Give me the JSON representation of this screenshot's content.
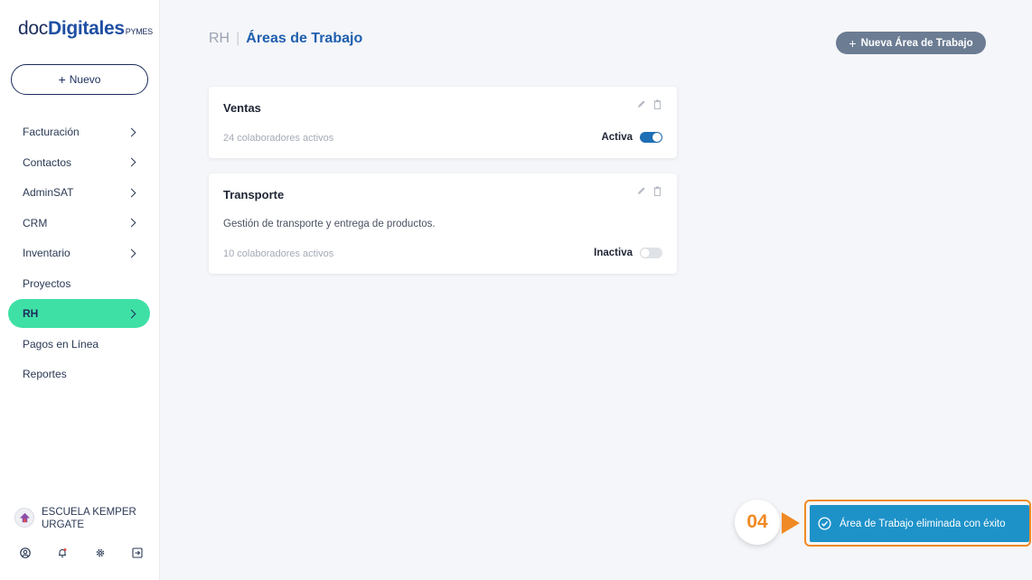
{
  "brand": {
    "part1": "doc",
    "part2": "Digitales",
    "suffix": "PYMES"
  },
  "sidebar": {
    "new_button": "Nuevo",
    "items": [
      {
        "label": "Facturación",
        "has_chevron": true
      },
      {
        "label": "Contactos",
        "has_chevron": true
      },
      {
        "label": "AdminSAT",
        "has_chevron": true
      },
      {
        "label": "CRM",
        "has_chevron": true
      },
      {
        "label": "Inventario",
        "has_chevron": true
      },
      {
        "label": "Proyectos",
        "has_chevron": false
      },
      {
        "label": "RH",
        "has_chevron": true,
        "active": true
      },
      {
        "label": "Pagos en Línea",
        "has_chevron": false
      },
      {
        "label": "Reportes",
        "has_chevron": false
      }
    ],
    "org_name_line1": "ESCUELA KEMPER",
    "org_name_line2": "URGATE",
    "bottom_icons": [
      "user-icon",
      "bell-icon",
      "gear-icon",
      "logout-icon"
    ]
  },
  "header": {
    "breadcrumb_root": "RH",
    "breadcrumb_sep": "|",
    "breadcrumb_current": "Áreas de Trabajo",
    "add_button": "Nueva Área de Trabajo"
  },
  "cards": [
    {
      "title": "Ventas",
      "description": "",
      "count": "24 colaboradores activos",
      "status": "Activa",
      "enabled": true
    },
    {
      "title": "Transporte",
      "description": "Gestión de transporte y entrega de productos.",
      "count": "10 colaboradores activos",
      "status": "Inactiva",
      "enabled": false
    }
  ],
  "tutorial": {
    "step": "04"
  },
  "toast": {
    "message": "Área de Trabajo eliminada con éxito"
  },
  "colors": {
    "accent_green": "#3fe0a6",
    "primary_blue": "#1f5fae",
    "toast_blue": "#1d92c9",
    "step_orange": "#f08a24"
  }
}
